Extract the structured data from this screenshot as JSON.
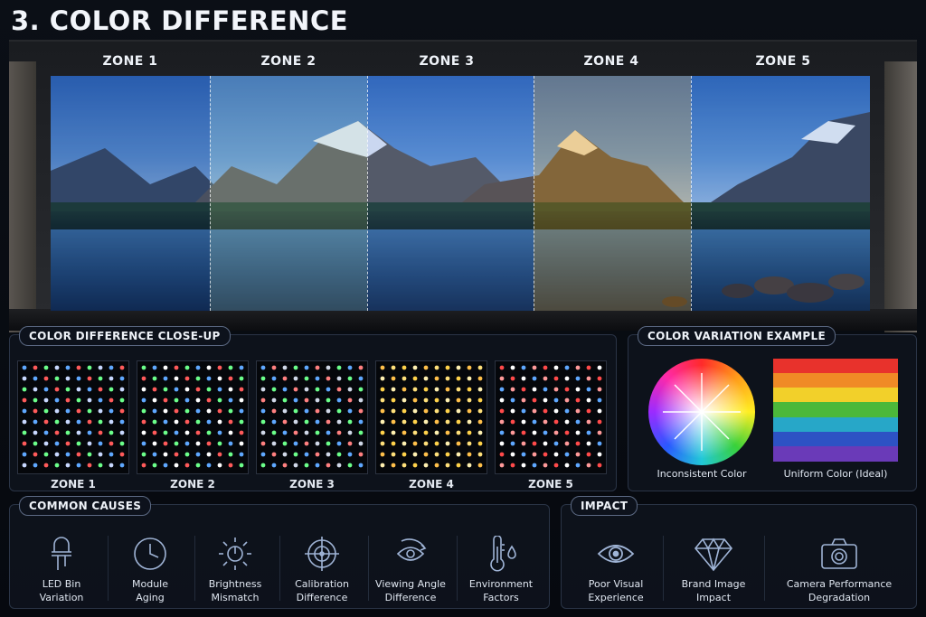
{
  "title": "3. COLOR DIFFERENCE",
  "wall": {
    "zones": [
      "ZONE 1",
      "ZONE 2",
      "ZONE 3",
      "ZONE 4",
      "ZONE 5"
    ]
  },
  "closeup": {
    "heading": "COLOR DIFFERENCE CLOSE-UP",
    "zones": [
      "ZONE 1",
      "ZONE 2",
      "ZONE 3",
      "ZONE 4",
      "ZONE 5"
    ]
  },
  "variation": {
    "heading": "COLOR VARIATION EXAMPLE",
    "inconsistent": "Inconsistent Color",
    "uniform": "Uniform Color (Ideal)"
  },
  "causes": {
    "heading": "COMMON CAUSES",
    "items": [
      {
        "line1": "LED Bin",
        "line2": "Variation",
        "icon": "led-icon"
      },
      {
        "line1": "Module",
        "line2": "Aging",
        "icon": "clock-icon"
      },
      {
        "line1": "Brightness",
        "line2": "Mismatch",
        "icon": "sun-icon"
      },
      {
        "line1": "Calibration",
        "line2": "Difference",
        "icon": "crosshair-icon"
      },
      {
        "line1": "Viewing Angle",
        "line2": "Difference",
        "icon": "eye-angle-icon"
      },
      {
        "line1": "Environment",
        "line2": "Factors",
        "icon": "thermometer-icon"
      }
    ]
  },
  "impact": {
    "heading": "IMPACT",
    "items": [
      {
        "line1": "Poor Visual",
        "line2": "Experience",
        "icon": "eye-icon"
      },
      {
        "line1": "Brand Image",
        "line2": "Impact",
        "icon": "diamond-icon"
      },
      {
        "line1": "Camera Performance",
        "line2": "Degradation",
        "icon": "camera-icon"
      }
    ]
  },
  "colors": {
    "accent": "#9fb4d6",
    "panel_border": "#2a3446",
    "zone_tints": [
      "#1c4f9a",
      "#4c7f8a",
      "#3d6ab8",
      "#b58a3a",
      "#2e66b8"
    ]
  }
}
